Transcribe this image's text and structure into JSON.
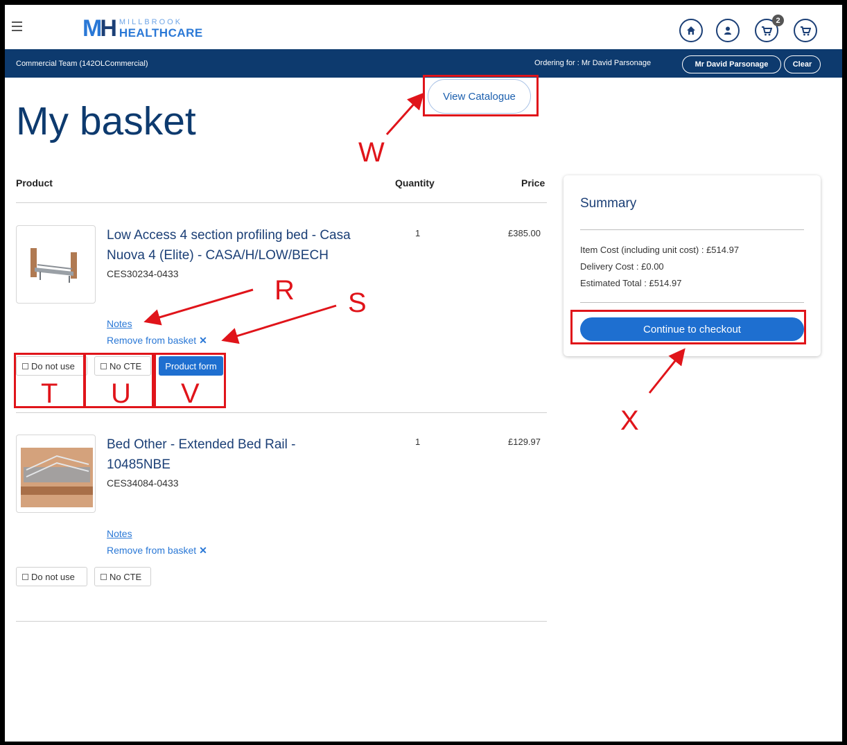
{
  "header": {
    "logo_top": "MILLBROOK",
    "logo_bottom": "HEALTHCARE",
    "cart_badge": "2",
    "icons": [
      "menu-icon",
      "home-icon",
      "user-icon",
      "basket-icon",
      "cart-icon"
    ]
  },
  "nav": {
    "team": "Commercial Team (142OLCommercial)",
    "ordering_for": "Ordering for : Mr David Parsonage",
    "customer_button": "Mr David Parsonage",
    "clear_button": "Clear"
  },
  "page": {
    "view_catalogue": "View Catalogue",
    "title": "My basket"
  },
  "table": {
    "col_product": "Product",
    "col_quantity": "Quantity",
    "col_price": "Price"
  },
  "items": [
    {
      "name": "Low Access 4 section profiling bed - Casa Nuova 4 (Elite) - CASA/H/LOW/BECH",
      "code": "CES30234-0433",
      "quantity": "1",
      "price": "£385.00",
      "notes": "Notes",
      "remove": "Remove from basket",
      "remove_icon": "close-icon",
      "do_not_use": "Do not use",
      "no_cte": "No CTE",
      "product_form": "Product form"
    },
    {
      "name": "Bed Other - Extended Bed Rail - 10485NBE",
      "code": "CES34084-0433",
      "quantity": "1",
      "price": "£129.97",
      "notes": "Notes",
      "remove": "Remove from basket",
      "remove_icon": "close-icon",
      "do_not_use": "Do not use",
      "no_cte": "No CTE"
    }
  ],
  "summary": {
    "title": "Summary",
    "item_cost": "Item Cost (including unit cost) : £514.97",
    "delivery_cost": "Delivery Cost : £0.00",
    "estimated_total": "Estimated Total : £514.97",
    "checkout": "Continue to checkout"
  },
  "annotations": {
    "R": "R",
    "S": "S",
    "T": "T",
    "U": "U",
    "V": "V",
    "W": "W",
    "X": "X",
    "color": "#e0141a"
  },
  "colors": {
    "navy": "#0d3a6e",
    "button_blue": "#1e6fd0",
    "link_blue": "#2a78d6"
  }
}
